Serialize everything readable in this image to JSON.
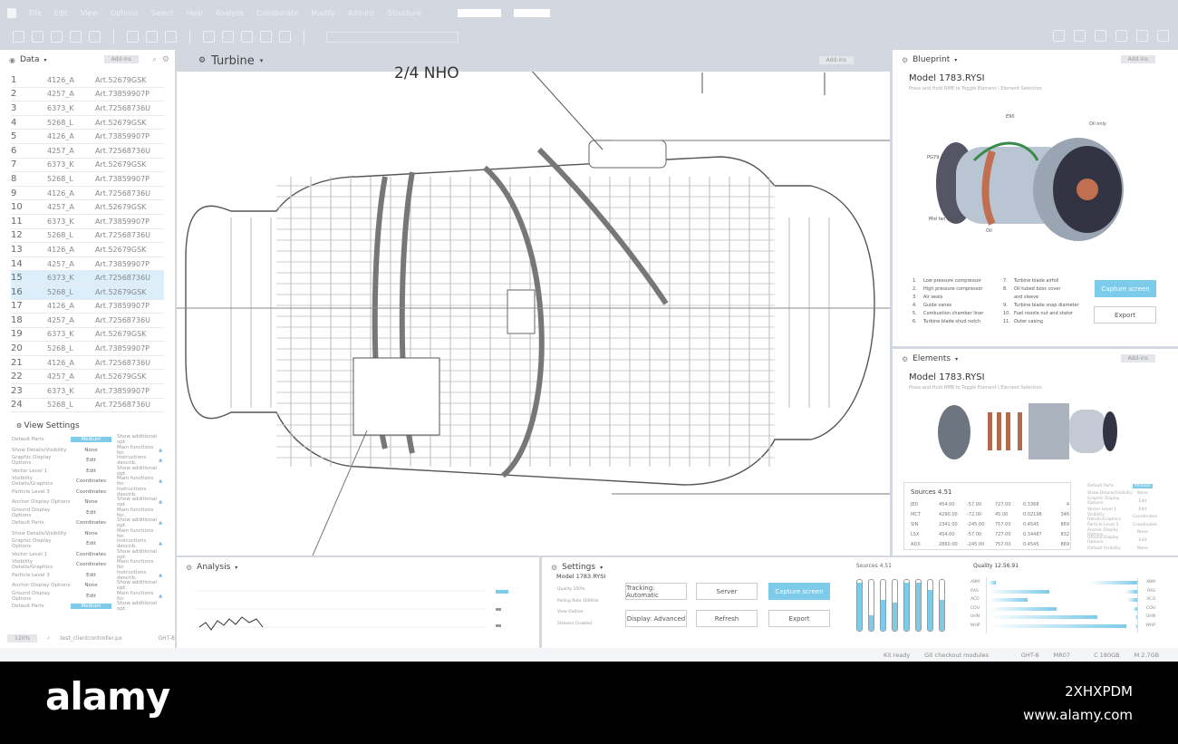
{
  "menu": [
    "File",
    "Edit",
    "View",
    "Options",
    "Select",
    "Help",
    "Analyze",
    "Collaborate",
    "Modify",
    "Add-Ins",
    "Structure"
  ],
  "left": {
    "title": "Data",
    "addins": "Add-ins",
    "rows": [
      [
        "1",
        "4126_A",
        "Art.52679GSK"
      ],
      [
        "2",
        "4257_A",
        "Art.73859907P"
      ],
      [
        "3",
        "6373_K",
        "Art.72568736U"
      ],
      [
        "4",
        "5268_L",
        "Art.52679GSK"
      ],
      [
        "5",
        "4126_A",
        "Art.73859907P"
      ],
      [
        "6",
        "4257_A",
        "Art.72568736U"
      ],
      [
        "7",
        "6373_K",
        "Art.52679GSK"
      ],
      [
        "8",
        "5268_L",
        "Art.73859907P"
      ],
      [
        "9",
        "4126_A",
        "Art.72568736U"
      ],
      [
        "10",
        "4257_A",
        "Art.52679GSK"
      ],
      [
        "11",
        "6373_K",
        "Art.73859907P"
      ],
      [
        "12",
        "5268_L",
        "Art.72568736U"
      ],
      [
        "13",
        "4126_A",
        "Art.52679GSK"
      ],
      [
        "14",
        "4257_A",
        "Art.73859907P"
      ],
      [
        "15",
        "6373_K",
        "Art.72568736U"
      ],
      [
        "16",
        "5268_L",
        "Art.52679GSK"
      ],
      [
        "17",
        "4126_A",
        "Art.73859907P"
      ],
      [
        "18",
        "4257_A",
        "Art.72568736U"
      ],
      [
        "19",
        "6373_K",
        "Art.52679GSK"
      ],
      [
        "20",
        "5268_L",
        "Art.73859907P"
      ],
      [
        "21",
        "4126_A",
        "Art.72568736U"
      ],
      [
        "22",
        "4257_A",
        "Art.52679GSK"
      ],
      [
        "23",
        "6373_K",
        "Art.73859907P"
      ],
      [
        "24",
        "5268_L",
        "Art.72568736U"
      ]
    ],
    "selected_rows": [
      "15",
      "16"
    ],
    "view_settings_title": "View Settings",
    "view_settings": [
      [
        "Default Parts",
        "Medium",
        "Show additional opt.",
        0
      ],
      [
        "Show Details/Visibility",
        "None",
        "Main functions for.",
        1
      ],
      [
        "Graphic Display Options",
        "Edit",
        "Instructions describ.",
        1
      ],
      [
        "Vector Level 1",
        "Edit",
        "Show additional opt.",
        0
      ],
      [
        "Visibility Details/Graphics",
        "Coordinates",
        "Main functions for.",
        1
      ],
      [
        "Particle Level 3",
        "Coordinates",
        "Instructions describ.",
        0
      ],
      [
        "Anchor Display Options",
        "None",
        "Show additional opt.",
        1
      ],
      [
        "Ground Display Options",
        "Edit",
        "Main functions for.",
        0
      ],
      [
        "Default Parts",
        "Coordinates",
        "Show additional opt.",
        1
      ],
      [
        "Show Details/Visibility",
        "None",
        "Main functions for.",
        0
      ],
      [
        "Graphic Display Options",
        "Edit",
        "Instructions describ.",
        1
      ],
      [
        "Vector Level 1",
        "Coordinates",
        "Show additional opt.",
        0
      ],
      [
        "Visibility Details/Graphics",
        "Coordinates",
        "Main functions for.",
        0
      ],
      [
        "Particle Level 3",
        "Edit",
        "Instructions describ.",
        1
      ],
      [
        "Anchor Display Options",
        "None",
        "Show additional opt.",
        0
      ],
      [
        "Ground Display Options",
        "Edit",
        "Main functions for.",
        1
      ],
      [
        "Default Parts",
        "Medium",
        "Show additional opt.",
        0
      ]
    ],
    "zoom": "120%",
    "file": "test_clientcontroller.px",
    "code": "GHT-8"
  },
  "main": {
    "title": "Turbine",
    "addins": "Add-ins",
    "label": "2/4  NHO"
  },
  "blueprint": {
    "title": "Blueprint",
    "addins": "Add-ins",
    "model": "Model 1783.RYSI",
    "hint": "Press and Hold RMB to Toggle Element \\ Element Selection",
    "callouts": [
      "E90",
      "Oil only",
      "PG79",
      "Mid fan support",
      "Oil"
    ],
    "parts": [
      "1.",
      "Low pressure compressor",
      "2.",
      "High pressure compressor",
      "3.",
      "Air seals",
      "4.",
      "Guide vanes",
      "5.",
      "Combustion chamber liner",
      "6.",
      "Turbine blade shud notch",
      "7.",
      "Turbine blade airfoil",
      "8.",
      "Oil tubed boss cover",
      "",
      "and sleeve",
      "9.",
      "Turbine blade snap diameter",
      "10.",
      "Fuel nozzle nut and stator",
      "11.",
      "Outer casing"
    ],
    "capture": "Capture screen",
    "export": "Export"
  },
  "elements": {
    "title": "Elements",
    "addins": "Add-ins",
    "model": "Model 1783.RYSI",
    "hint": "Press and Hold RMB to Toggle Element \\ Element Selection",
    "sources_title": "Sources 4.51",
    "sources": [
      [
        "JED",
        "454.00",
        "-57.00",
        "727.00",
        "0.3368",
        "4"
      ],
      [
        "MCT",
        "4290.00",
        "-72.00",
        "45.00",
        "0.02198",
        "346"
      ],
      [
        "SIN",
        "2341.00",
        "-245.00",
        "757.00",
        "0.4545",
        "869"
      ],
      [
        "LSX",
        "454.00",
        "-57.00",
        "727.00",
        "0.34487",
        "832"
      ],
      [
        "ADX",
        "2860.00",
        "-245.00",
        "757.00",
        "0.4545",
        "869"
      ]
    ],
    "settings": [
      [
        "Default Parts",
        "Medium"
      ],
      [
        "Show Details/Visibility",
        "None"
      ],
      [
        "Graphic Display Options",
        "Edit"
      ],
      [
        "Vector Level 1",
        "Edit"
      ],
      [
        "Visibility Details/Graphics",
        "Coordinates"
      ],
      [
        "Particle Level 3",
        "Coordinates"
      ],
      [
        "Anchor Display Options",
        "None"
      ],
      [
        "Ground Display Options",
        "Edit"
      ],
      [
        "Default Visibility",
        "None"
      ]
    ]
  },
  "analysis": {
    "title": "Analysis"
  },
  "settings": {
    "title": "Settings",
    "model": "Model 1783.RYSI",
    "info": [
      "Quality 100%",
      "Polling Rate 1000Hz",
      "View Outline",
      "Streams Enabled"
    ],
    "buttons": {
      "tracking": "Tracking: Automatic",
      "server": "Server",
      "capture": "Capture screen",
      "display": "Display: Advanced",
      "refresh": "Refresh",
      "export": "Export"
    },
    "sources_title": "Sources 4.51",
    "slider_levels": [
      0.95,
      0.3,
      0.6,
      0.55,
      0.95,
      0.95,
      0.8,
      0.6
    ],
    "quality_title": "Quality 12.56.91",
    "quality": [
      {
        "label": "ABM",
        "left": 0.05,
        "right": 0.33
      },
      {
        "label": "RAS",
        "left": 0.42,
        "right": 0.08
      },
      {
        "label": "ACO",
        "left": 0.27,
        "right": 0.07
      },
      {
        "label": "COU",
        "left": 0.47,
        "right": 0.03
      },
      {
        "label": "UHN",
        "left": 0.75,
        "right": 0.01
      },
      {
        "label": "WHP",
        "left": 0.95,
        "right": 0.01
      }
    ]
  },
  "status": {
    "kit": "Kit ready",
    "git": "Git checkout modules",
    "code": "GHT-8",
    "mr": "MR07",
    "c": "C  180GB",
    "m": "M  2.7GB"
  },
  "watermark": {
    "brand": "alamy",
    "id": "2XHXPDM",
    "url": "www.alamy.com"
  },
  "colors": {
    "accent": "#7ccbea",
    "chrome": "#d3d7df"
  }
}
